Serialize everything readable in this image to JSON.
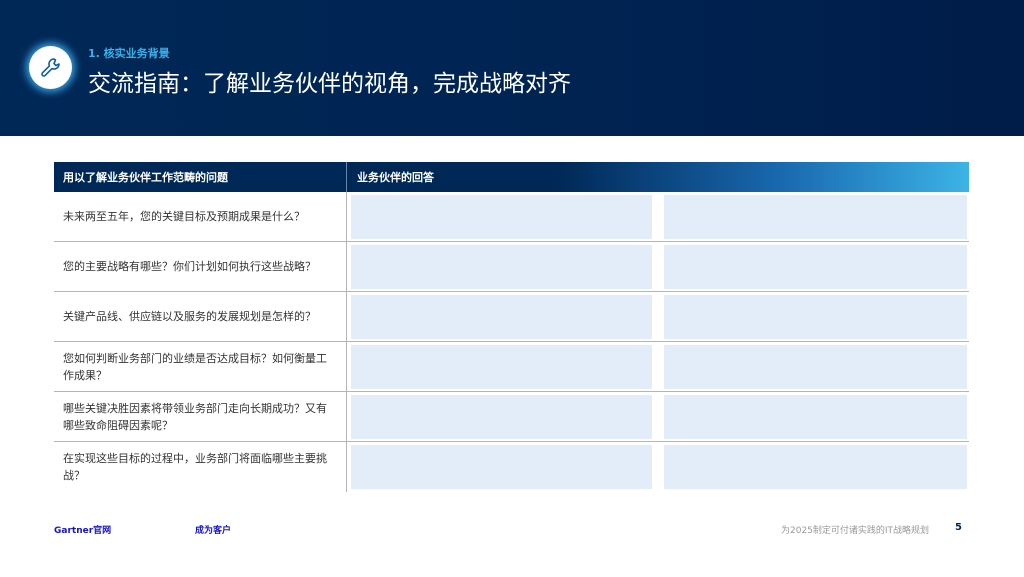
{
  "header": {
    "kicker": "1. 核实业务背景",
    "title": "交流指南：了解业务伙伴的视角，完成战略对齐",
    "icon": "wrench-icon"
  },
  "table": {
    "headers": [
      "用以了解业务伙伴工作范畴的问题",
      "业务伙伴的回答"
    ],
    "rows": [
      "未来两至五年，您的关键目标及预期成果是什么？",
      "您的主要战略有哪些？你们计划如何执行这些战略？",
      "关键产品线、供应链以及服务的发展规划是怎样的？",
      "您如何判断业务部门的业绩是否达成目标？如何衡量工作成果？",
      "哪些关键决胜因素将带领业务部门走向长期成功？又有哪些致命阻碍因素呢？",
      "在实现这些目标的过程中，业务部门将面临哪些主要挑战？"
    ]
  },
  "footer": {
    "link1": "Gartner官网",
    "link2": "成为客户",
    "doc_title": "为2025制定可付诸实践的IT战略规划",
    "page": "5"
  }
}
